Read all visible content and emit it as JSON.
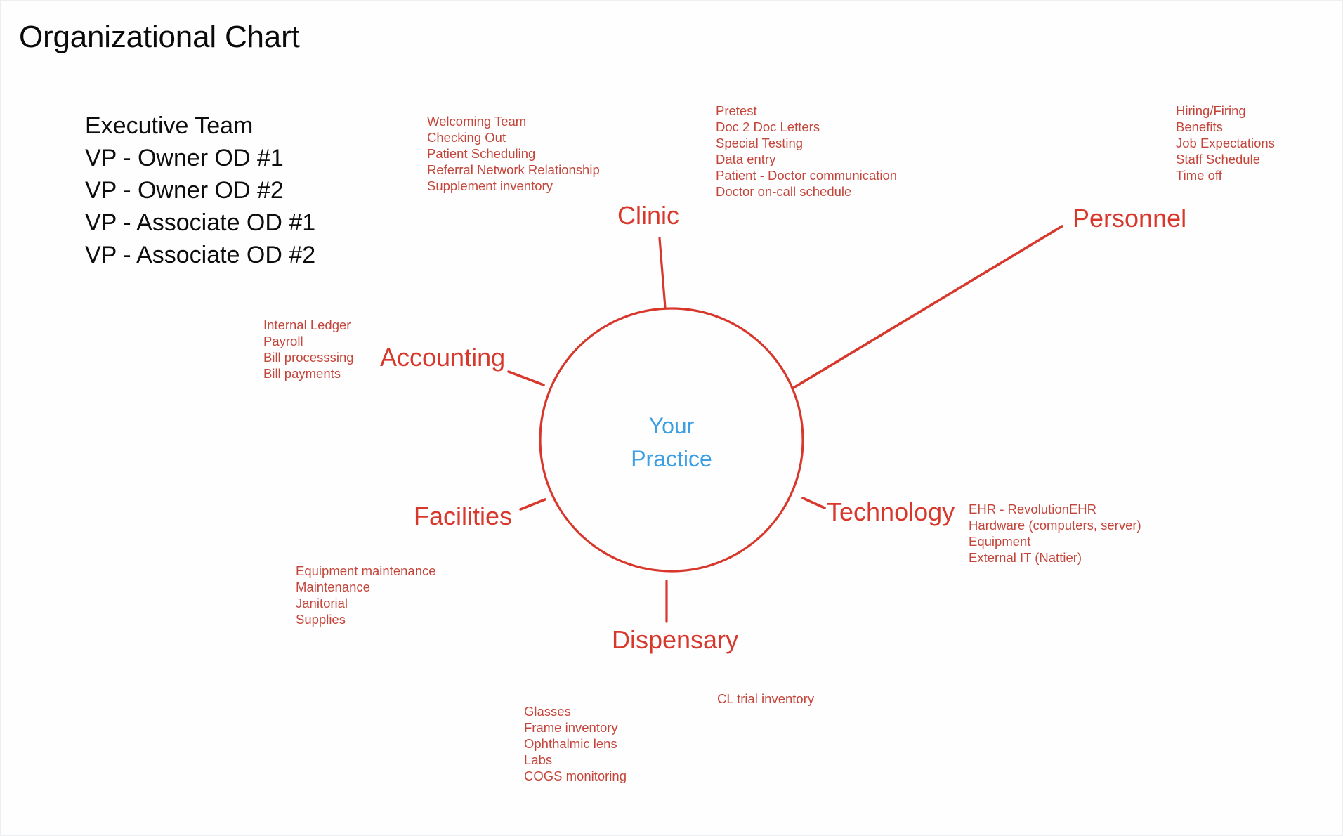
{
  "page": {
    "title": "Organizational Chart"
  },
  "executive_team": {
    "heading": "Executive Team",
    "members": [
      "VP - Owner OD #1",
      "VP - Owner OD #2",
      "VP - Associate OD #1",
      "VP - Associate OD #2"
    ]
  },
  "center": {
    "line1": "Your",
    "line2": "Practice"
  },
  "colors": {
    "accent_red": "#d8382c",
    "detail_red": "#c4453a",
    "center_blue": "#3c9fe3",
    "title_black": "#0a0a0a",
    "background": "#fefeff"
  },
  "chart_data": {
    "type": "diagram",
    "diagram_style": "hub-and-spoke mind map",
    "title": "Organizational Chart",
    "hub": "Your Practice",
    "branches": [
      {
        "label": "Clinic",
        "position": "top",
        "items": [
          "Welcoming Team",
          "Checking Out",
          "Patient Scheduling",
          "Referral Network Relationship",
          "Supplement inventory"
        ],
        "extra_items": [
          "Pretest",
          "Doc 2 Doc Letters",
          "Special Testing",
          "Data entry",
          "Patient - Doctor communication",
          "Doctor on-call schedule"
        ]
      },
      {
        "label": "Personnel",
        "position": "top-right",
        "items": [
          "Hiring/Firing",
          "Benefits",
          "Job Expectations",
          "Staff Schedule",
          "Time off"
        ]
      },
      {
        "label": "Technology",
        "position": "right",
        "items": [
          "EHR - RevolutionEHR",
          "Hardware (computers, server)",
          "Equipment",
          "External IT (Nattier)"
        ]
      },
      {
        "label": "Dispensary",
        "position": "bottom",
        "items": [
          "Glasses",
          "Frame inventory",
          "Ophthalmic lens",
          "Labs",
          "COGS monitoring"
        ],
        "extra_items": [
          "CL trial inventory"
        ]
      },
      {
        "label": "Facilities",
        "position": "bottom-left",
        "items": [
          "Equipment maintenance",
          "Maintenance",
          "Janitorial",
          "Supplies"
        ]
      },
      {
        "label": "Accounting",
        "position": "left",
        "items": [
          "Internal Ledger",
          "Payroll",
          "Bill processsing",
          "Bill payments"
        ]
      }
    ]
  }
}
